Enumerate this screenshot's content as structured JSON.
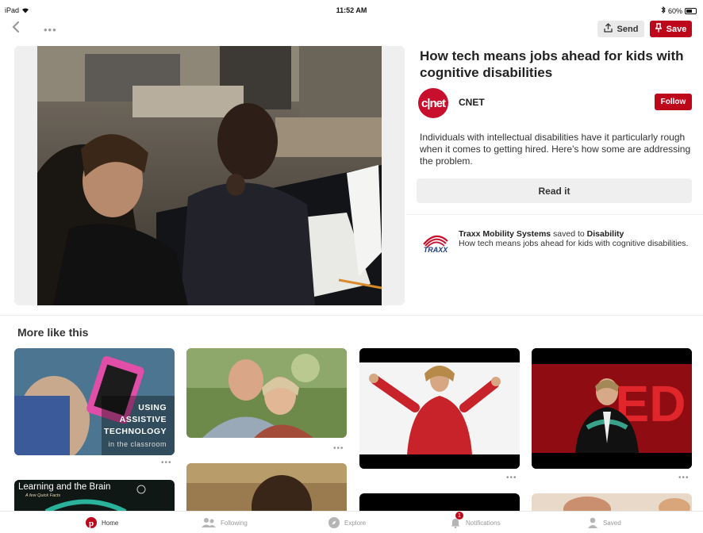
{
  "status_bar": {
    "device": "iPad",
    "time": "11:52 AM",
    "battery_text": "60%",
    "battery_level": 0.6
  },
  "toolbar": {
    "send_label": "Send",
    "save_label": "Save"
  },
  "pin": {
    "title": "How tech means jobs ahead for kids with cognitive disabilities",
    "source_logo_text": "c|net",
    "source_name": "CNET",
    "follow_label": "Follow",
    "description": "Individuals with intellectual disabilities have it particularly rough when it comes to getting hired. Here's how some are addressing the problem.",
    "read_label": "Read it"
  },
  "saved_by": {
    "logo_text": "TRAXX",
    "user": "Traxx Mobility Systems",
    "verb": " saved to ",
    "board": "Disability",
    "caption": "How tech means jobs ahead for kids with cognitive disabilities."
  },
  "more": {
    "title": "More like this",
    "cards": [
      {
        "name": "assistive-tech",
        "overlay_lines": [
          "USING",
          "ASSISTIVE",
          "TECHNOLOGY"
        ],
        "overlay_sub": "in the classroom"
      },
      {
        "name": "couple-photo"
      },
      {
        "name": "woman-red-shirt"
      },
      {
        "name": "ted-talk"
      },
      {
        "name": "learning-brain",
        "overlay_title": "Learning and the Brain",
        "overlay_sub": "A few Quick Facts"
      }
    ]
  },
  "tabs": [
    {
      "label": "Home",
      "icon": "pinterest-icon"
    },
    {
      "label": "Following",
      "icon": "following-icon"
    },
    {
      "label": "Explore",
      "icon": "compass-icon"
    },
    {
      "label": "Notifications",
      "icon": "bell-icon",
      "badge": "1"
    },
    {
      "label": "Saved",
      "icon": "person-icon"
    }
  ],
  "colors": {
    "brand_red": "#bd081c",
    "button_gray": "#efefef"
  }
}
